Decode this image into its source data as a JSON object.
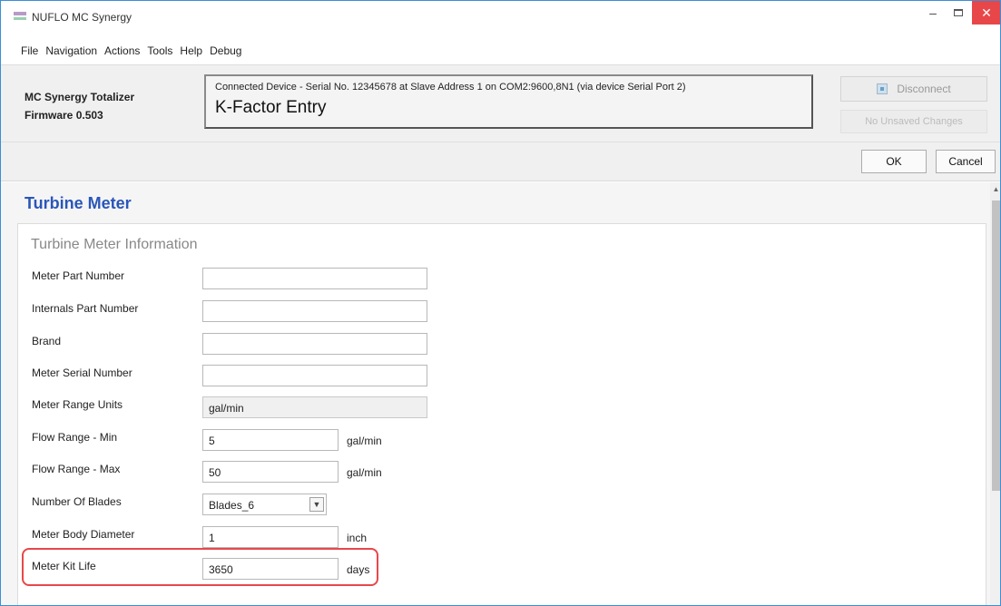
{
  "window": {
    "title": "NUFLO MC Synergy",
    "minimize_glyph": "–",
    "close_glyph": "✕"
  },
  "menu": [
    "File",
    "Navigation",
    "Actions",
    "Tools",
    "Help",
    "Debug"
  ],
  "header": {
    "device_name": "MC Synergy Totalizer",
    "firmware": "Firmware 0.503",
    "connection_text": "Connected Device -  Serial No. 12345678 at Slave Address 1 on COM2:9600,8N1 (via device Serial Port 2)",
    "screen_title": "K-Factor Entry",
    "disconnect_label": "Disconnect",
    "unsaved_label": "No Unsaved Changes"
  },
  "actions": {
    "ok_label": "OK",
    "cancel_label": "Cancel"
  },
  "section": {
    "title": "Turbine Meter",
    "group_title": "Turbine Meter Information",
    "rows": [
      {
        "label": "Meter Part Number",
        "value": "",
        "unit": ""
      },
      {
        "label": "Internals Part Number",
        "value": "",
        "unit": ""
      },
      {
        "label": "Brand",
        "value": "",
        "unit": ""
      },
      {
        "label": "Meter Serial Number",
        "value": "",
        "unit": ""
      },
      {
        "label": "Meter Range Units",
        "value": "gal/min",
        "unit": ""
      },
      {
        "label": "Flow Range - Min",
        "value": "5",
        "unit": "gal/min"
      },
      {
        "label": "Flow Range - Max",
        "value": "50",
        "unit": "gal/min"
      },
      {
        "label": "Number Of Blades",
        "value": "Blades_6",
        "unit": ""
      },
      {
        "label": "Meter Body Diameter",
        "value": "1",
        "unit": "inch"
      },
      {
        "label": "Meter Kit Life",
        "value": "3650",
        "unit": "days"
      }
    ]
  },
  "colors": {
    "accent": "#2a56b8",
    "highlight": "#e8474a",
    "close_button": "#e8474a"
  },
  "icons": {
    "app": "app-icon",
    "disconnect": "plug-icon",
    "dropdown": "chevron-down-icon",
    "scroll_up": "chevron-up-icon"
  }
}
